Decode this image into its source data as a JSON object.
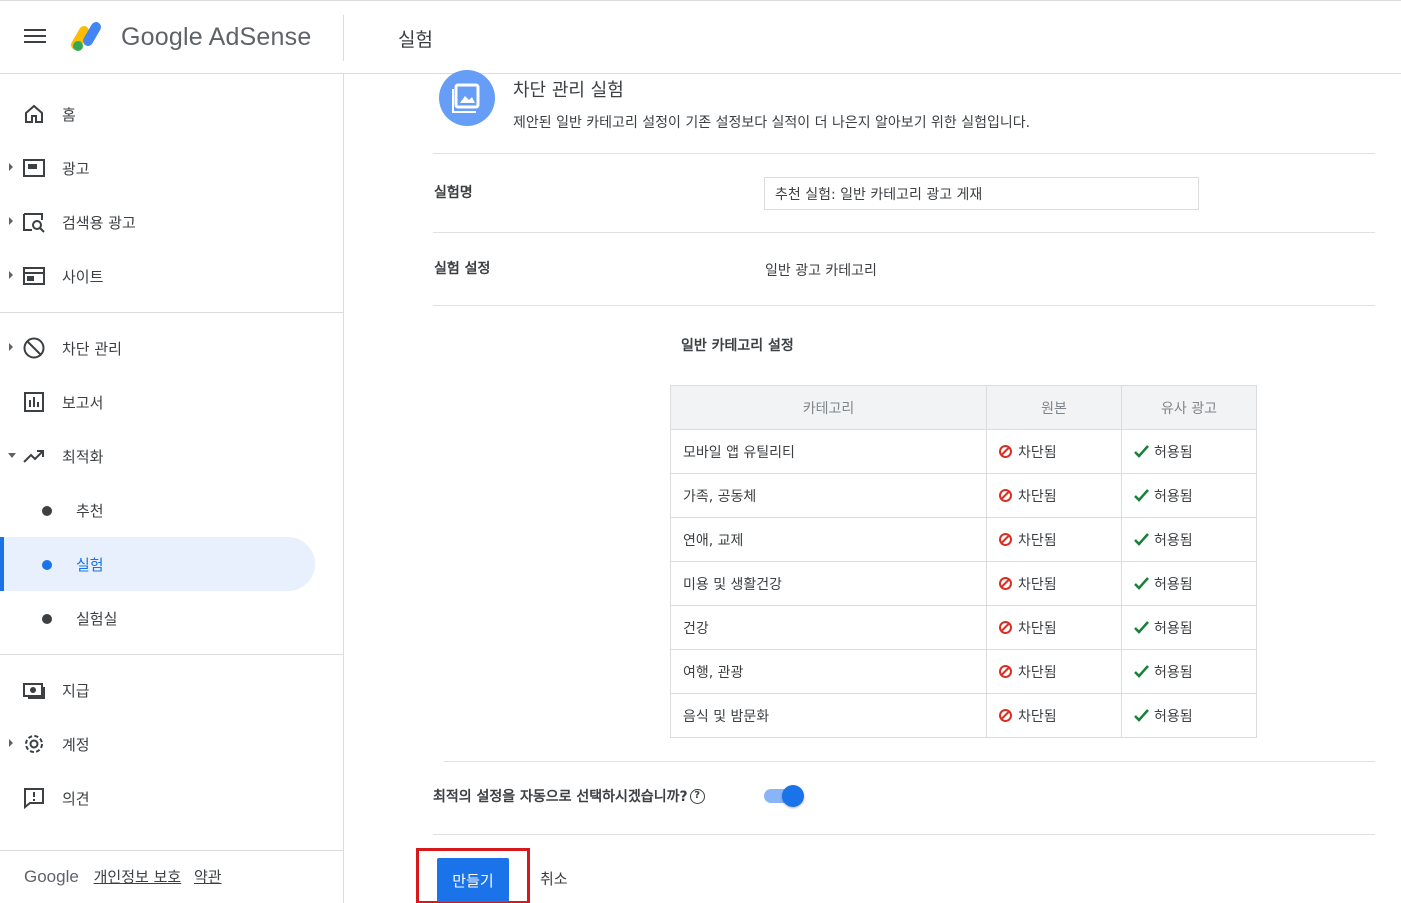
{
  "header": {
    "logo_text": "Google AdSense",
    "title": "실험"
  },
  "sidebar": {
    "items": [
      {
        "label": "홈",
        "icon": "home-icon"
      },
      {
        "label": "광고",
        "icon": "ads-icon"
      },
      {
        "label": "검색용 광고",
        "icon": "search-ads-icon"
      },
      {
        "label": "사이트",
        "icon": "sites-icon"
      },
      {
        "label": "차단 관리",
        "icon": "block-icon"
      },
      {
        "label": "보고서",
        "icon": "reports-icon"
      },
      {
        "label": "최적화",
        "icon": "trending-icon"
      },
      {
        "label": "추천",
        "icon": "dot-icon"
      },
      {
        "label": "실험",
        "icon": "dot-icon"
      },
      {
        "label": "실험실",
        "icon": "dot-icon"
      },
      {
        "label": "지급",
        "icon": "payments-icon"
      },
      {
        "label": "계정",
        "icon": "gear-icon"
      },
      {
        "label": "의견",
        "icon": "feedback-icon"
      }
    ],
    "footer": {
      "brand": "Google",
      "privacy": "개인정보 보호",
      "terms": "약관"
    }
  },
  "experiment": {
    "title": "차단 관리 실험",
    "description": "제안된 일반 카테고리 설정이 기존 설정보다 실적이 더 나은지 알아보기 위한 실험입니다.",
    "name_label": "실험명",
    "name_value": "추천 실험: 일반 카테고리 광고 게재",
    "settings_label": "실험 설정",
    "settings_value": "일반 광고 카테고리",
    "table_title": "일반 카테고리 설정",
    "table": {
      "headers": [
        "카테고리",
        "원본",
        "유사 광고"
      ],
      "rows": [
        [
          "모바일 앱 유틸리티",
          "차단됨",
          "허용됨"
        ],
        [
          "가족, 공동체",
          "차단됨",
          "허용됨"
        ],
        [
          "연애, 교제",
          "차단됨",
          "허용됨"
        ],
        [
          "미용 및 생활건강",
          "차단됨",
          "허용됨"
        ],
        [
          "건강",
          "차단됨",
          "허용됨"
        ],
        [
          "여행, 관광",
          "차단됨",
          "허용됨"
        ],
        [
          "음식 및 밤문화",
          "차단됨",
          "허용됨"
        ]
      ]
    },
    "auto_label": "최적의 설정을 자동으로 선택하시겠습니까?",
    "auto_toggle_on": true,
    "create_label": "만들기",
    "cancel_label": "취소"
  },
  "colors": {
    "accent": "#1a73e8",
    "blocked": "#d93025",
    "allowed": "#188038",
    "highlight": "#d7191c"
  }
}
